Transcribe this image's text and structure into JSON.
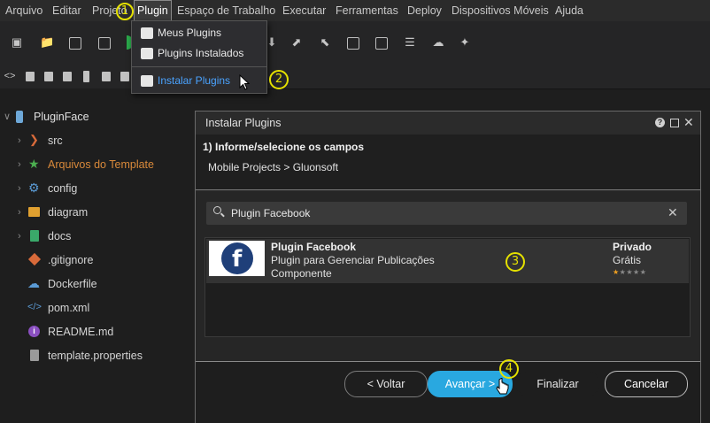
{
  "menubar": {
    "items": [
      "Arquivo",
      "Editar",
      "Projeto",
      "Plugin",
      "Espaço de Trabalho",
      "Executar",
      "Ferramentas",
      "Deploy",
      "Dispositivos Móveis",
      "Ajuda"
    ]
  },
  "plugin_menu": {
    "items": [
      "Meus Plugins",
      "Plugins Instalados",
      "Instalar Plugins"
    ],
    "highlighted_color": "#4aa3ff"
  },
  "tree": {
    "root": "PluginFace",
    "items": [
      "src",
      "Arquivos do Template",
      "config",
      "diagram",
      "docs",
      ".gitignore",
      "Dockerfile",
      "pom.xml",
      "README.md",
      "template.properties"
    ],
    "highlight_color": "#d9893a"
  },
  "dialog": {
    "title": "Instalar Plugins",
    "step_title": "1) Informe/selecione os campos",
    "breadcrumb": "Mobile Projects > Gluonsoft",
    "search": {
      "value": "Plugin Facebook"
    },
    "result": {
      "name": "Plugin Facebook",
      "description": "Plugin para Gerenciar Publicações",
      "type": "Componente",
      "visibility": "Privado",
      "price": "Grátis",
      "rating": 1,
      "rating_max": 5
    },
    "buttons": {
      "back": "< Voltar",
      "next": "Avançar >",
      "finish": "Finalizar",
      "cancel": "Cancelar"
    },
    "accent_color": "#29a8e0"
  },
  "callouts": [
    "1",
    "2",
    "3",
    "4"
  ]
}
